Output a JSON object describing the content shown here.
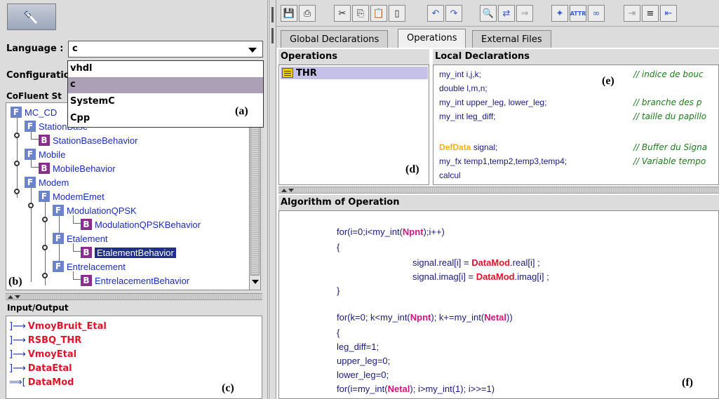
{
  "language": {
    "label": "Language :",
    "selected": "c",
    "options": [
      "vhdl",
      "c",
      "SystemC",
      "Cpp"
    ]
  },
  "configuration_label": "Configuratio",
  "tree": {
    "title": "CoFluent St",
    "nodes": [
      {
        "icon": "F",
        "label": "MC_CD"
      },
      {
        "icon": "F",
        "label": "StationBase"
      },
      {
        "icon": "B",
        "label": "StationBaseBehavior"
      },
      {
        "icon": "F",
        "label": "Mobile"
      },
      {
        "icon": "B",
        "label": "MobileBehavior"
      },
      {
        "icon": "F",
        "label": "Modem"
      },
      {
        "icon": "F",
        "label": "ModemEmet"
      },
      {
        "icon": "F",
        "label": "ModulationQPSK"
      },
      {
        "icon": "B",
        "label": "ModulationQPSKBehavior"
      },
      {
        "icon": "F",
        "label": "Etalement"
      },
      {
        "icon": "B",
        "label": "EtalementBehavior"
      },
      {
        "icon": "F",
        "label": "Entrelacement"
      },
      {
        "icon": "B",
        "label": "EntrelacementBehavior"
      }
    ]
  },
  "io": {
    "header": "Input/Output",
    "items": [
      {
        "arrow": "]⟶",
        "label": "VmoyBruit_Etal"
      },
      {
        "arrow": "]⟶",
        "label": "RSBQ_THR"
      },
      {
        "arrow": "]⟶",
        "label": "VmoyEtal"
      },
      {
        "arrow": "]⟶",
        "label": "DataEtal"
      },
      {
        "arrow": "⟹[",
        "label": "DataMod"
      }
    ]
  },
  "panel_tags": {
    "a": "(a)",
    "b": "(b)",
    "c": "(c)",
    "d": "(d)",
    "e": "(e)",
    "f": "(f)"
  },
  "toolbar": {
    "buttons": [
      "save-icon",
      "print-icon",
      "cut-icon",
      "copy-icon",
      "paste-icon",
      "new-icon",
      "undo-icon",
      "redo-icon",
      "find-icon",
      "replace-icon",
      "arrow-icon",
      "tool-a-icon",
      "attr-icon",
      "link-icon",
      "export-icon",
      "doc-icon",
      "import-icon"
    ]
  },
  "tabs": [
    "Global Declarations",
    "Operations",
    "External Files"
  ],
  "active_tab": "Operations",
  "operations": {
    "header": "Operations",
    "items": [
      "THR"
    ]
  },
  "declarations": {
    "header": "Local Declarations",
    "lines": [
      {
        "code": "my_int i,j,k;",
        "comment": "// indice de bouc"
      },
      {
        "code": "double l,m,n;",
        "comment": ""
      },
      {
        "code": "my_int upper_leg, lower_leg;",
        "comment": "// branche des p"
      },
      {
        "code": "my_int leg_diff;",
        "comment": "// taille du papillo"
      },
      {
        "code": "",
        "comment": ""
      },
      {
        "code": "DefData signal;",
        "comment": "// Buffer du Signa"
      },
      {
        "code": "my_fx temp1,temp2,temp3,temp4;",
        "comment": "// Variable tempo"
      },
      {
        "code": "calcul",
        "comment": ""
      }
    ],
    "highlight_keyword": "DefData",
    "highlight_rest": " signal;"
  },
  "algorithm": {
    "header": "Algorithm of Operation",
    "l1_pre": "for(i=0;i<my_int(",
    "l1_hl": "Npnt",
    "l1_post": ");i++)",
    "l2": "{",
    "l3_pre": "signal.real[i] = ",
    "l3_hl": "DataMod",
    "l3_post": ".real[i] ;",
    "l4_pre": "signal.imag[i] = ",
    "l4_hl": "DataMod",
    "l4_post": ".imag[i] ;",
    "l5": "}",
    "l6_pre": "for(k=0; k<my_int(",
    "l6_hl": "Npnt",
    "l6_mid": "); k+=my_int(",
    "l6_hl2": "Netal",
    "l6_post": "))",
    "l7": "{",
    "l8": "leg_diff=1;",
    "l9": "upper_leg=0;",
    "l10": "lower_leg=0;",
    "l11_pre": "for(i=my_int(",
    "l11_hl": "Netal",
    "l11_post": "); i>my_int(1); i>>=1)"
  },
  "colors": {
    "tree_text": "#1c2fb0",
    "io_text": "#e0142a",
    "keyword_magenta": "#d0167c",
    "comment_green": "#1d7a1d",
    "selection": "#1f2f8a"
  }
}
